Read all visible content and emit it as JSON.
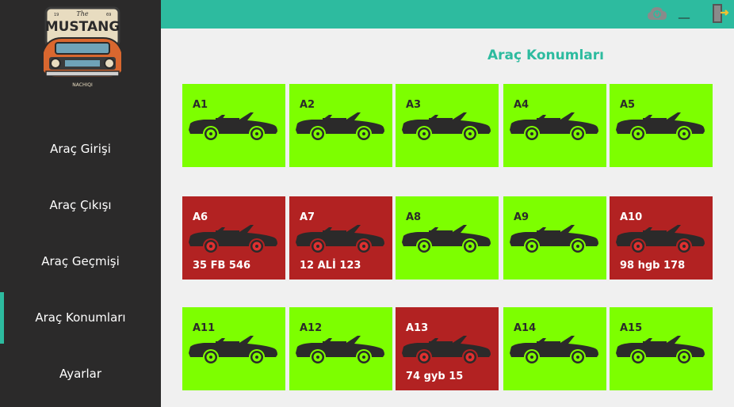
{
  "sidebar": {
    "logo_text": {
      "top": "The",
      "main": "MUSTANG",
      "years_left": "19",
      "years_right": "69",
      "tag": "NACHIQI"
    },
    "items": [
      {
        "label": "Araç Girişi",
        "active": false
      },
      {
        "label": "Araç Çıkışı",
        "active": false
      },
      {
        "label": "Araç Geçmişi",
        "active": false
      },
      {
        "label": "Araç Konumları",
        "active": true
      },
      {
        "label": "Ayarlar",
        "active": false
      }
    ],
    "accent_color": "#2dbb9f"
  },
  "topbar": {
    "color": "#2dbb9f",
    "icons": [
      "cloud-power-icon",
      "minimize-icon",
      "exit-icon"
    ],
    "minimize_label": "__"
  },
  "main": {
    "title": "Araç Konumları",
    "colors": {
      "free": "#7dff00",
      "occupied": "#b22222"
    },
    "slots": [
      {
        "id": "A1",
        "status": "free",
        "plate": ""
      },
      {
        "id": "A2",
        "status": "free",
        "plate": ""
      },
      {
        "id": "A3",
        "status": "free",
        "plate": ""
      },
      {
        "id": "A4",
        "status": "free",
        "plate": ""
      },
      {
        "id": "A5",
        "status": "free",
        "plate": ""
      },
      {
        "id": "A6",
        "status": "occupied",
        "plate": "35 FB 546"
      },
      {
        "id": "A7",
        "status": "occupied",
        "plate": "12 ALİ 123"
      },
      {
        "id": "A8",
        "status": "free",
        "plate": ""
      },
      {
        "id": "A9",
        "status": "free",
        "plate": ""
      },
      {
        "id": "A10",
        "status": "occupied",
        "plate": "98 hgb 178"
      },
      {
        "id": "A11",
        "status": "free",
        "plate": ""
      },
      {
        "id": "A12",
        "status": "free",
        "plate": ""
      },
      {
        "id": "A13",
        "status": "occupied",
        "plate": "74 gyb 15"
      },
      {
        "id": "A14",
        "status": "free",
        "plate": ""
      },
      {
        "id": "A15",
        "status": "free",
        "plate": ""
      }
    ]
  }
}
